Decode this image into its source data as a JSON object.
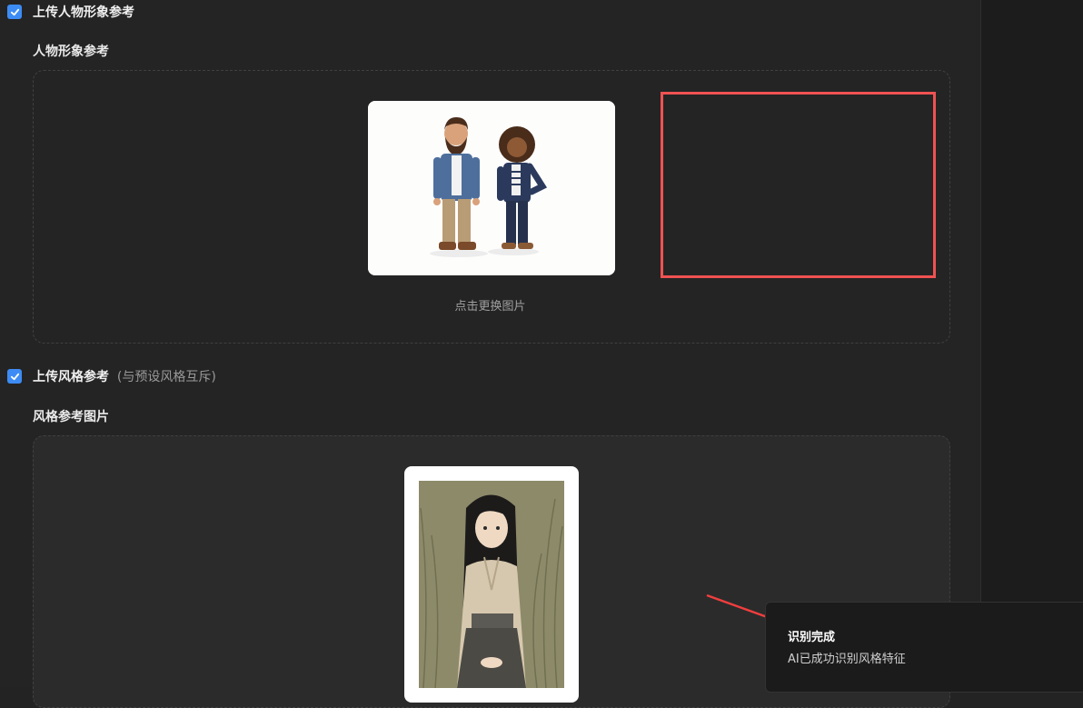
{
  "person_section": {
    "checkbox_label": "上传人物形象参考",
    "label": "人物形象参考",
    "change_image": "点击更换图片"
  },
  "style_section": {
    "checkbox_label": "上传风格参考",
    "checkbox_hint": "(与预设风格互斥)",
    "label": "风格参考图片"
  },
  "toast": {
    "title": "识别完成",
    "message": "AI已成功识别风格特征"
  },
  "colors": {
    "accent": "#3d8cf5",
    "highlight_frame": "#f05252"
  }
}
